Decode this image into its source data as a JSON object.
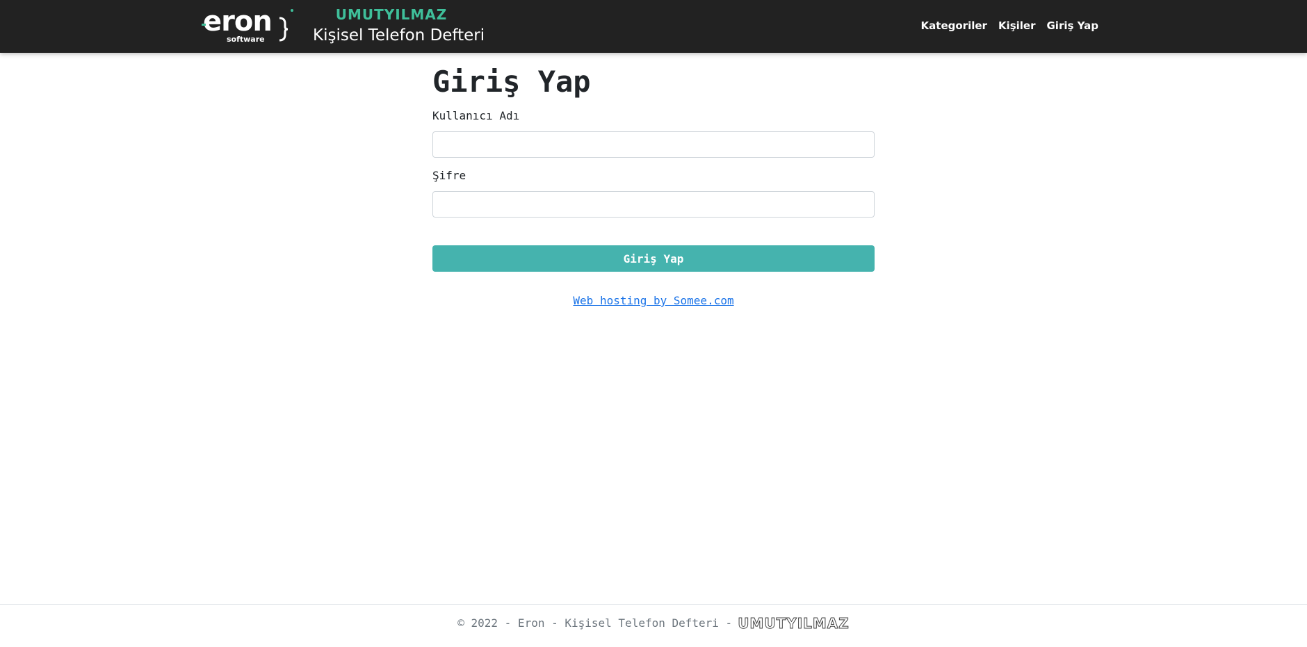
{
  "navbar": {
    "brand_logo_name": "eron software",
    "brand_logo_line1": "eron",
    "brand_logo_line2": "software",
    "author": "UMUTYILMAZ",
    "subtitle": "Kişisel Telefon Defteri",
    "links": [
      {
        "label": "Kategoriler"
      },
      {
        "label": "Kişiler"
      },
      {
        "label": "Giriş Yap"
      }
    ]
  },
  "login": {
    "title": "Giriş Yap",
    "username_label": "Kullanıcı Adı",
    "username_value": "",
    "password_label": "Şifre",
    "password_value": "",
    "submit_label": "Giriş Yap"
  },
  "hosting": {
    "link_text": "Web hosting by Somee.com"
  },
  "footer": {
    "text": "© 2022 - Eron - Kişisel Telefon Defteri -",
    "author": "UMUTYILMAZ"
  },
  "colors": {
    "navbar_bg": "#222222",
    "accent": "#45b3ae",
    "author_green": "#3fbf9a",
    "link": "#1a73e8"
  }
}
